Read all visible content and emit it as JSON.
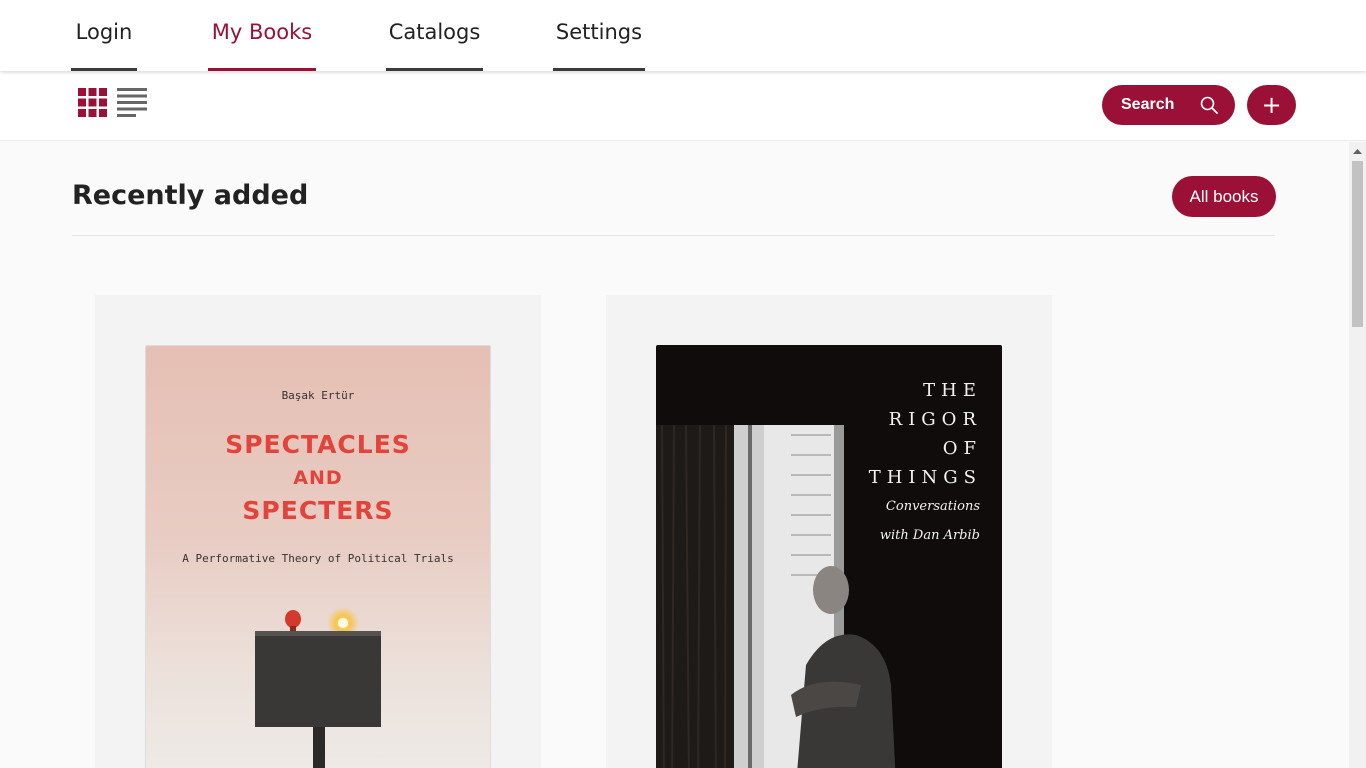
{
  "nav": {
    "tabs": [
      {
        "label": "Login"
      },
      {
        "label": "My Books",
        "active": true
      },
      {
        "label": "Catalogs"
      },
      {
        "label": "Settings"
      }
    ]
  },
  "toolbar": {
    "view_modes": [
      "grid-icon",
      "list-icon"
    ],
    "active_view": "grid",
    "search_label": "Search",
    "add_label": "+"
  },
  "section": {
    "title": "Recently added",
    "all_books_label": "All books"
  },
  "books": [
    {
      "author": "Başak Ertür",
      "title_lines": [
        "SPECTACLES",
        "AND",
        "SPECTERS"
      ],
      "subtitle": "A Performative Theory of Political Trials"
    },
    {
      "title_lines": [
        "THE",
        "RIGOR",
        "OF",
        "THINGS"
      ],
      "subtitle_lines": [
        "Conversations",
        "with Dan Arbib"
      ]
    }
  ],
  "colors": {
    "accent": "#9b1036",
    "background": "#fafafa",
    "card": "#f3f3f3",
    "title_red": "#e2433a"
  }
}
